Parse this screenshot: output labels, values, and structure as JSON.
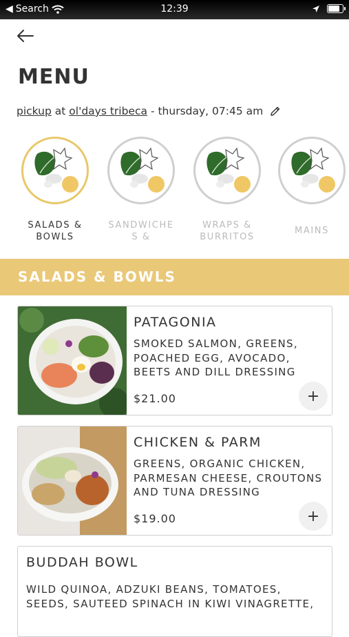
{
  "status_bar": {
    "carrier": "Search",
    "time": "12:39"
  },
  "title": "MENU",
  "order": {
    "mode": "pickup",
    "connector": "at",
    "location": "ol'days tribeca",
    "schedule": "- thursday, 07:45 am"
  },
  "categories": [
    {
      "label": "SALADS & BOWLS",
      "active": true
    },
    {
      "label": "SANDWICHE S &",
      "active": false
    },
    {
      "label": "WRAPS & BURRITOS",
      "active": false
    },
    {
      "label": "MAINS",
      "active": false
    }
  ],
  "section_title": "SALADS & BOWLS",
  "items": [
    {
      "name": "PATAGONIA",
      "description": "SMOKED SALMON, GREENS, POACHED EGG, AVOCADO, BEETS AND DILL DRESSING",
      "price": "$21.00"
    },
    {
      "name": "CHICKEN & PARM",
      "description": "GREENS, ORGANIC CHICKEN, PARMESAN CHEESE, CROUTONS AND TUNA DRESSING",
      "price": "$19.00"
    },
    {
      "name": "BUDDAH BOWL",
      "description": "WILD QUINOA, ADZUKI BEANS, TOMATOES, SEEDS, SAUTEED SPINACH IN KIWI VINAGRETTE,"
    }
  ],
  "colors": {
    "accent": "#e9c878",
    "active_ring": "#e8c86a",
    "inactive_ring": "#cfcfcf",
    "text": "#333333"
  }
}
